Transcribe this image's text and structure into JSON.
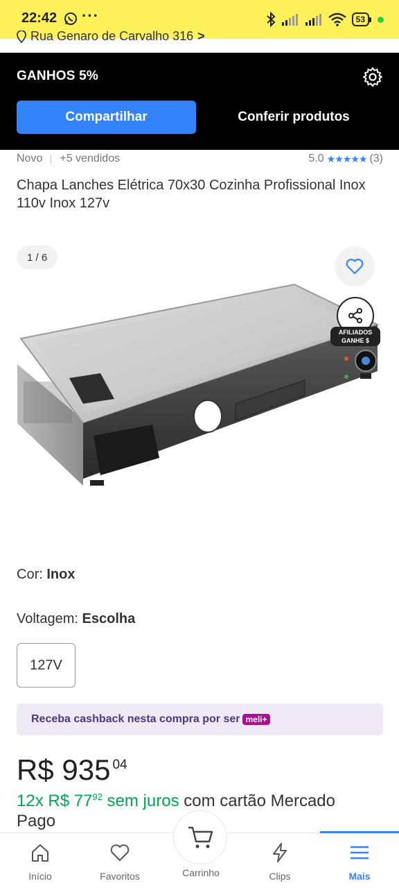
{
  "status_bar": {
    "time": "22:42",
    "battery": "53"
  },
  "address": {
    "text": "Rua Genaro de Carvalho 316",
    "chevron": ">"
  },
  "affiliate": {
    "title": "GANHOS 5%",
    "share_label": "Compartilhar",
    "check_label": "Conferir produtos"
  },
  "product": {
    "condition": "Novo",
    "sold": "+5 vendidos",
    "rating": "5.0",
    "stars": "★★★★★",
    "reviews": "(3)",
    "title": "Chapa Lanches Elétrica 70x30 Cozinha Profissional Inox 110v Inox 127v",
    "image_counter": "1 / 6",
    "affiliate_badge_line1": "AFILIADOS",
    "affiliate_badge_line2": "GANHE $"
  },
  "options": {
    "color_label": "Cor: ",
    "color_value": "Inox",
    "voltage_label": "Voltagem: ",
    "voltage_value": "Escolha",
    "voltage_option": "127V"
  },
  "cashback": {
    "text": "Receba cashback nesta compra por ser",
    "badge": "meli+"
  },
  "price": {
    "main": "R$ 935",
    "cents": "04",
    "installments_count": "12x R$ 77",
    "installments_cents": "92",
    "installments_free": " sem juros",
    "installments_rest": " com cartão Mercado Pago"
  },
  "bottom_nav": {
    "items": [
      {
        "label": "Início",
        "icon": "home-icon"
      },
      {
        "label": "Favoritos",
        "icon": "heart-icon"
      },
      {
        "label": "Carrinho",
        "icon": "cart-icon"
      },
      {
        "label": "Clips",
        "icon": "clips-icon"
      },
      {
        "label": "Mais",
        "icon": "menu-icon"
      }
    ]
  },
  "colors": {
    "brand_yellow": "#fff159",
    "accent_blue": "#3483fa",
    "green": "#00a650"
  }
}
